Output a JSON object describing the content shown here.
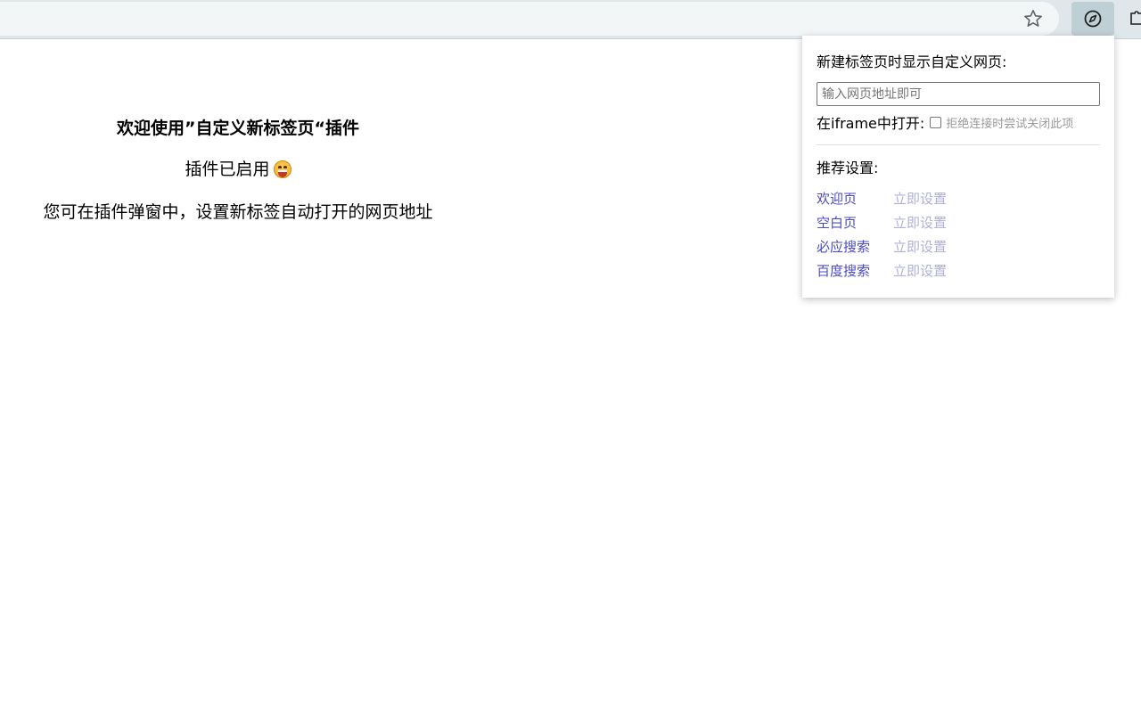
{
  "browser": {
    "star_icon": "star-outline-icon",
    "extension_icon": "compass-icon",
    "puzzle_icon": "puzzle-icon"
  },
  "page": {
    "title": "欢迎使用”自定义新标签页“插件",
    "enabled_text": "插件已启用",
    "emoji": "grinning-face-emoji",
    "hint": "您可在插件弹窗中，设置新标签自动打开的网页地址"
  },
  "popup": {
    "heading": "新建标签页时显示自定义网页:",
    "url_placeholder": "输入网页地址即可",
    "url_value": "",
    "iframe_label": "在iframe中打开:",
    "iframe_checked": false,
    "iframe_checkbox_label": "拒绝连接时尝试关闭此项",
    "recommend_heading": "推荐设置:",
    "recommendations": [
      {
        "name": "欢迎页",
        "action": "立即设置"
      },
      {
        "name": "空白页",
        "action": "立即设置"
      },
      {
        "name": "必应搜索",
        "action": "立即设置"
      },
      {
        "name": "百度搜索",
        "action": "立即设置"
      }
    ]
  },
  "colors": {
    "link": "#4b4bc4",
    "action": "#b0b0d8",
    "toolbar": "#dfe7ea"
  }
}
